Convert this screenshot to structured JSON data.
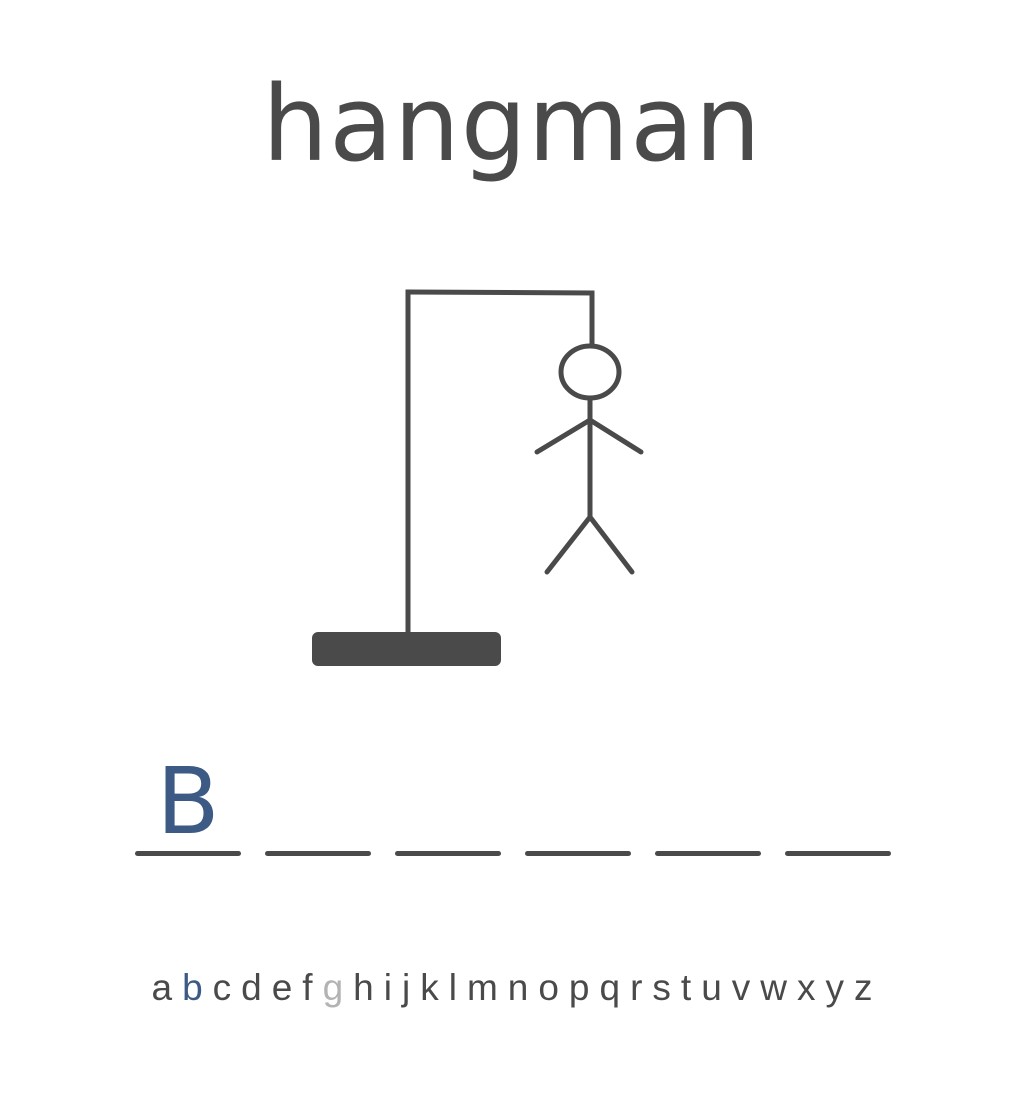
{
  "title": "hangman",
  "word": {
    "slots": [
      "B",
      "",
      "",
      "",
      "",
      ""
    ]
  },
  "alphabet": [
    {
      "letter": "a",
      "state": "unused"
    },
    {
      "letter": "b",
      "state": "correct"
    },
    {
      "letter": "c",
      "state": "unused"
    },
    {
      "letter": "d",
      "state": "unused"
    },
    {
      "letter": "e",
      "state": "unused"
    },
    {
      "letter": "f",
      "state": "unused"
    },
    {
      "letter": "g",
      "state": "wrong"
    },
    {
      "letter": "h",
      "state": "unused"
    },
    {
      "letter": "i",
      "state": "unused"
    },
    {
      "letter": "j",
      "state": "unused"
    },
    {
      "letter": "k",
      "state": "unused"
    },
    {
      "letter": "l",
      "state": "unused"
    },
    {
      "letter": "m",
      "state": "unused"
    },
    {
      "letter": "n",
      "state": "unused"
    },
    {
      "letter": "o",
      "state": "unused"
    },
    {
      "letter": "p",
      "state": "unused"
    },
    {
      "letter": "q",
      "state": "unused"
    },
    {
      "letter": "r",
      "state": "unused"
    },
    {
      "letter": "s",
      "state": "unused"
    },
    {
      "letter": "t",
      "state": "unused"
    },
    {
      "letter": "u",
      "state": "unused"
    },
    {
      "letter": "v",
      "state": "unused"
    },
    {
      "letter": "w",
      "state": "unused"
    },
    {
      "letter": "x",
      "state": "unused"
    },
    {
      "letter": "y",
      "state": "unused"
    },
    {
      "letter": "z",
      "state": "unused"
    }
  ],
  "colors": {
    "ink": "#4a4a4a",
    "correct": "#3d5a85",
    "wrong": "#b3b3b3",
    "background": "#ffffff"
  }
}
